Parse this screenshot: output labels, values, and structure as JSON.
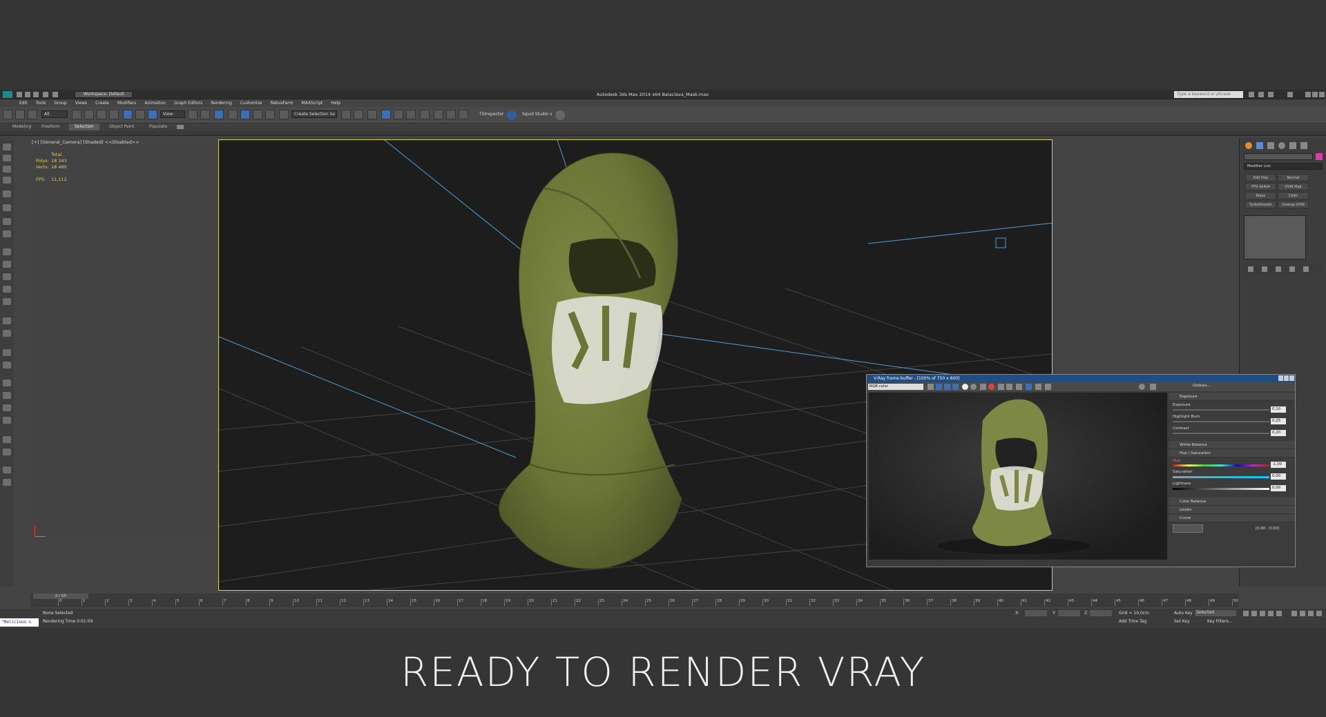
{
  "window": {
    "title": "Autodesk 3ds Max  2014 x64     Balaclava_Mask.max",
    "workspace": "Workspace: Default",
    "search_placeholder": "Type a keyword or phrase"
  },
  "menu": [
    "Edit",
    "Tools",
    "Group",
    "Views",
    "Create",
    "Modifiers",
    "Animation",
    "Graph Editors",
    "Rendering",
    "Customize",
    "RebusFarm",
    "MAXScript",
    "Help"
  ],
  "toolbar": {
    "filter_all": "All",
    "view": "View",
    "selection_set": "Create Selection Se",
    "tsinspector": "TSInspector",
    "squid": "Squid Studio v"
  },
  "ribbon_tabs": [
    "Modeling",
    "Freeform",
    "Selection",
    "Object Paint",
    "Populate"
  ],
  "viewport": {
    "label": "[+] [General_Camera] [Shaded] <<Disabled>>",
    "stats": [
      {
        "label": "",
        "value": "Total"
      },
      {
        "label": "Polys:",
        "value": "18 343"
      },
      {
        "label": "Verts:",
        "value": "18 480"
      },
      {
        "label": "FPS:",
        "value": "11,112"
      }
    ]
  },
  "modifier_panel": {
    "list_label": "Modifier List",
    "buttons": [
      "Edit Poly",
      "Normal",
      "FFD 4x4x4",
      "UVW Map",
      "Relax",
      "Cloth",
      "TurboSmooth",
      "Unwrap UVW"
    ]
  },
  "timeline": {
    "frame_display": "0 / 50",
    "ticks": [
      "0",
      "1",
      "2",
      "3",
      "4",
      "5",
      "6",
      "7",
      "8",
      "9",
      "10",
      "11",
      "12",
      "13",
      "14",
      "15",
      "16",
      "17",
      "18",
      "19",
      "20",
      "21",
      "22",
      "23",
      "24",
      "25",
      "26",
      "27",
      "28",
      "29",
      "30",
      "31",
      "32",
      "33",
      "34",
      "35",
      "36",
      "37",
      "38",
      "39",
      "40",
      "41",
      "42",
      "43",
      "44",
      "45",
      "46",
      "47",
      "48",
      "49",
      "50"
    ]
  },
  "status": {
    "script_box": "\"Malicious s",
    "selection": "None Selected",
    "render_time": "Rendering Time  0:01:09",
    "x_label": "X:",
    "y_label": "Y:",
    "z_label": "Z:",
    "grid": "Grid = 10,0cm",
    "add_time_tag": "Add Time Tag",
    "auto_key": "Auto Key",
    "auto_key_value": "Selected",
    "set_key": "Set Key",
    "key_filters": "Key Filters..."
  },
  "vfb": {
    "title": "V-Ray frame buffer - [100% of 750 x 600]",
    "channel": "RGB color",
    "globals": "Globals...",
    "exposure_header": "Exposure",
    "exposure_label": "Exposure",
    "exposure_value": "0,10",
    "highlight_label": "Highlight Burn",
    "highlight_value": "0,25",
    "contrast_label": "Contrast",
    "contrast_value": "0,20",
    "white_balance": "White Balance",
    "hue_sat_header": "Hue / Saturation",
    "hue_label": "Hue",
    "hue_value": "-1,00",
    "saturation_label": "Saturation",
    "saturation_value": "0,00",
    "lightness_label": "Lightness",
    "lightness_value": "0,00",
    "color_balance": "Color Balance",
    "levels": "Levels",
    "curve": "Curve",
    "curve_coords": "[0,00 ; 0,00]"
  },
  "caption": "READY TO RENDER VRAY",
  "colors": {
    "viewport_border": "#d9d14e",
    "mask_green": "#6f7a3c",
    "skull_white": "#e6e6e0",
    "camera_lines": "#4ea0d8",
    "vfb_title": "#1f4d87"
  }
}
